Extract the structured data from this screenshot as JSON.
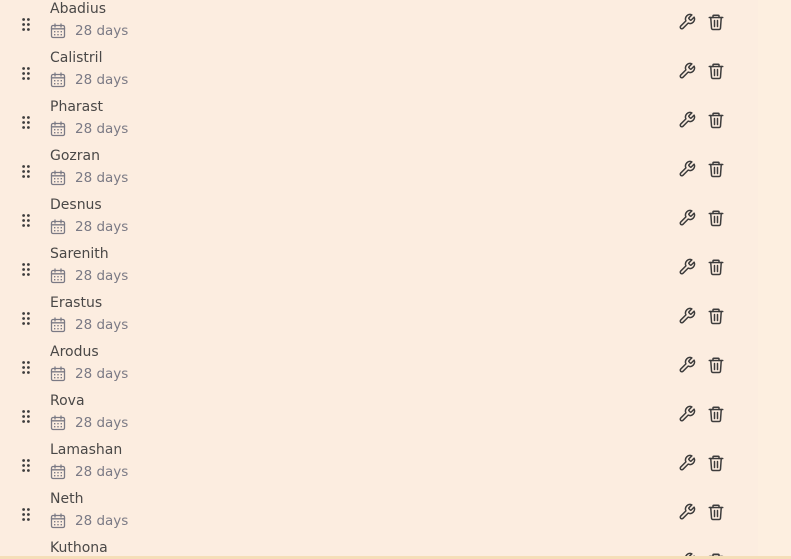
{
  "list": {
    "items": [
      {
        "name": "Abadius",
        "duration": "28 days"
      },
      {
        "name": "Calistril",
        "duration": "28 days"
      },
      {
        "name": "Pharast",
        "duration": "28 days"
      },
      {
        "name": "Gozran",
        "duration": "28 days"
      },
      {
        "name": "Desnus",
        "duration": "28 days"
      },
      {
        "name": "Sarenith",
        "duration": "28 days"
      },
      {
        "name": "Erastus",
        "duration": "28 days"
      },
      {
        "name": "Arodus",
        "duration": "28 days"
      },
      {
        "name": "Rova",
        "duration": "28 days"
      },
      {
        "name": "Lamashan",
        "duration": "28 days"
      },
      {
        "name": "Neth",
        "duration": "28 days"
      },
      {
        "name": "Kuthona",
        "duration": ""
      }
    ]
  },
  "icons": {
    "drag": "drag-handle-icon",
    "calendar": "calendar-icon",
    "edit": "wrench-icon",
    "delete": "trash-icon"
  },
  "colors": {
    "background": "#fcede0",
    "text": "#4a4847",
    "muted": "#7b7a85",
    "icon": "#3d3c3c"
  }
}
